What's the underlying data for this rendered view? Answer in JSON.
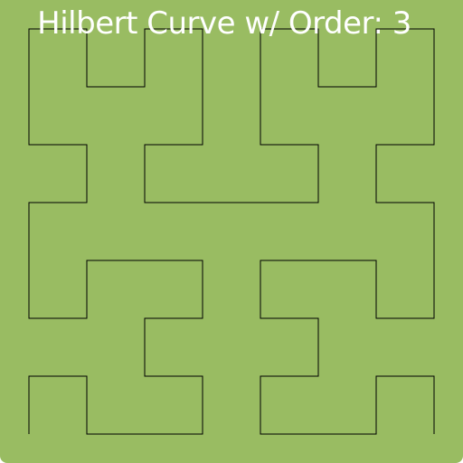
{
  "title": "Hilbert Curve w/ Order: 3",
  "curve": {
    "order": 3
  },
  "colors": {
    "background": "#99bc62",
    "line": "#000000",
    "title_text": "#ffffff"
  }
}
